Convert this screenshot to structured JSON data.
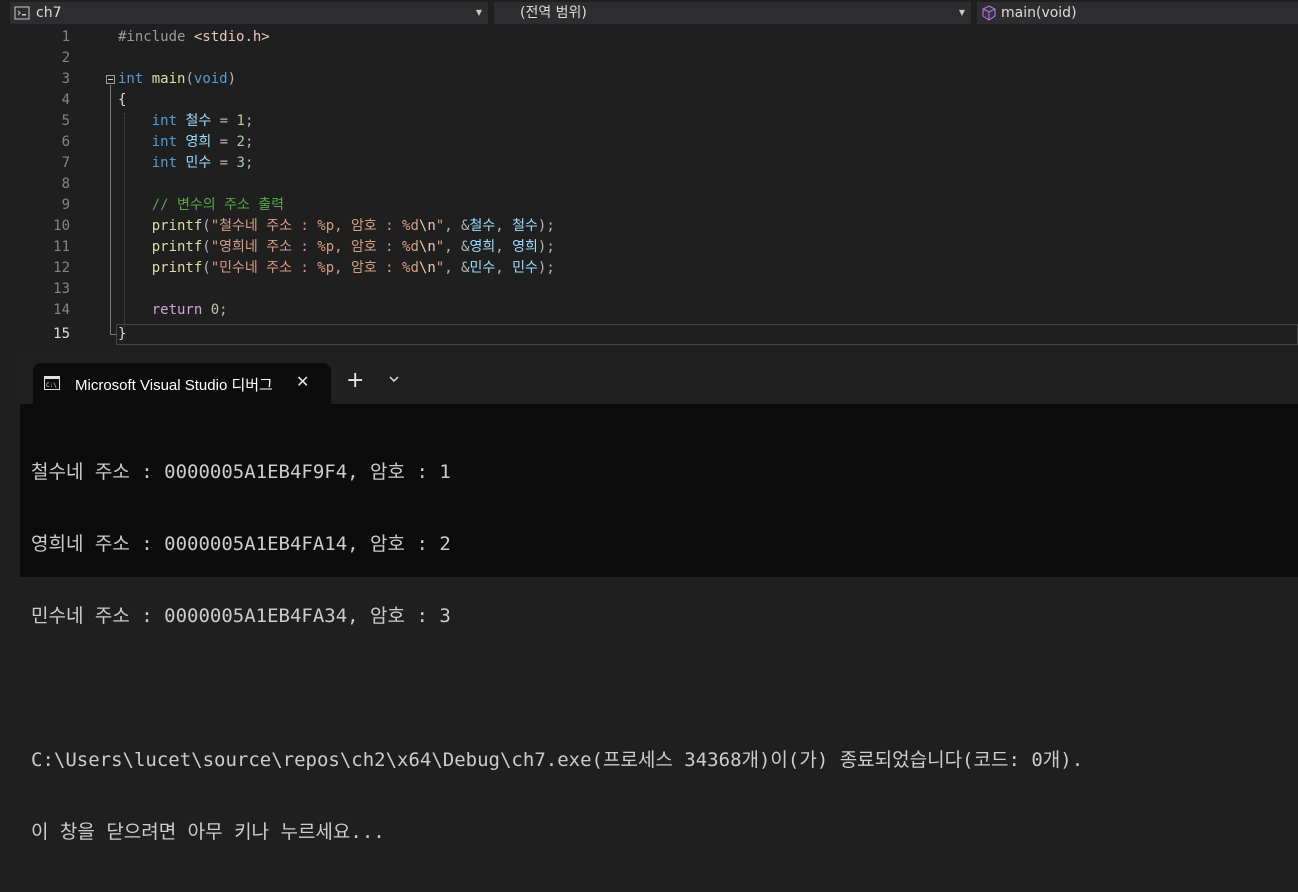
{
  "navbar": {
    "project": "ch7",
    "scope": "(전역 범위)",
    "member": "main(void)"
  },
  "editor": {
    "line_numbers": [
      "1",
      "2",
      "3",
      "4",
      "5",
      "6",
      "7",
      "8",
      "9",
      "10",
      "11",
      "12",
      "13",
      "14",
      "15"
    ],
    "current_line": "15",
    "code": {
      "l1_directive": "#include",
      "l1_header": "<stdio.h>",
      "l3_type": "int",
      "l3_func": "main",
      "l3_params": "void",
      "l4_brace": "{",
      "decl_type": "int",
      "var1": "철수",
      "val1": "1",
      "var2": "영희",
      "val2": "2",
      "var3": "민수",
      "val3": "3",
      "comment": "// 변수의 주소 출력",
      "printf": "printf",
      "fmt1": "\"철수네 주소 : %p, 암호 : %d",
      "fmt2": "\"영희네 주소 : %p, 암호 : %d",
      "fmt3": "\"민수네 주소 : %p, 암호 : %d",
      "esc": "\\n",
      "quote": "\"",
      "return_kw": "return",
      "return_val": "0",
      "l15_brace": "}"
    }
  },
  "terminal": {
    "tab_title": "Microsoft Visual Studio 디버그",
    "output": [
      "철수네 주소 : 0000005A1EB4F9F4, 암호 : 1",
      "영희네 주소 : 0000005A1EB4FA14, 암호 : 2",
      "민수네 주소 : 0000005A1EB4FA34, 암호 : 3",
      "",
      "C:\\Users\\lucet\\source\\repos\\ch2\\x64\\Debug\\ch7.exe(프로세스 34368개)이(가) 종료되었습니다(코드: 0개).",
      "이 창을 닫으려면 아무 키나 누르세요..."
    ]
  },
  "icons": {
    "project": "project-icon",
    "member": "cube-icon",
    "terminal": "terminal-icon",
    "close": "close-icon",
    "add": "plus-icon",
    "dropdown": "chevron-down-icon"
  }
}
